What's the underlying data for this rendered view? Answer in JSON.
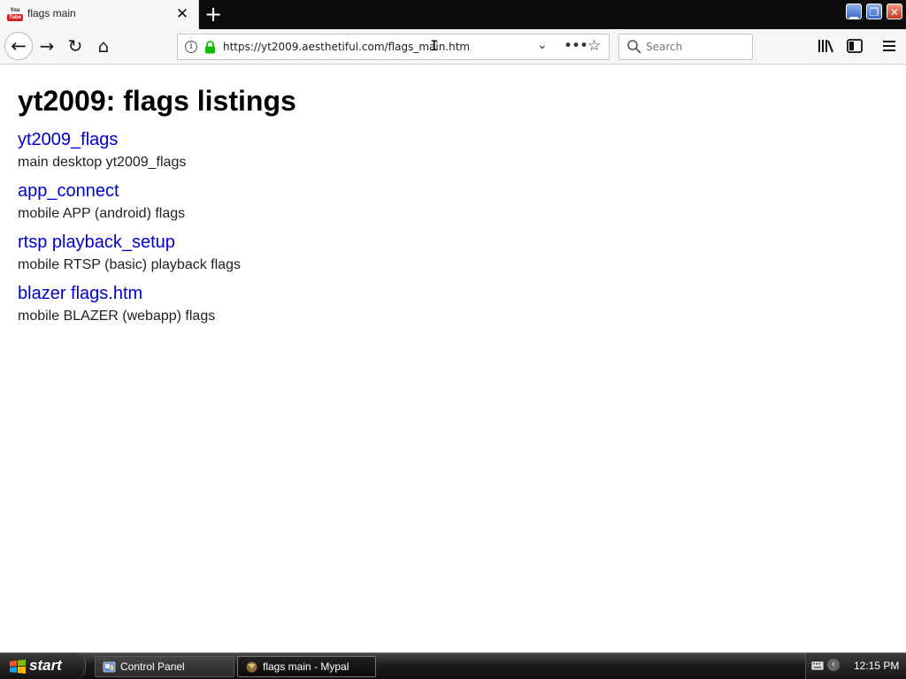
{
  "browser": {
    "tab": {
      "favicon_top": "You",
      "favicon_bottom": "Tube",
      "title": "flags main",
      "close_glyph": "✕"
    },
    "new_tab_glyph": "+",
    "window_controls": {
      "minimize": "▁",
      "maximize": "❐",
      "close": "✕"
    },
    "nav": {
      "back": "←",
      "forward": "→",
      "reload": "↻",
      "home": "⌂"
    },
    "url": "https://yt2009.aesthetiful.com/flags_main.htm",
    "url_info_glyph": "i",
    "url_dropdown_glyph": "⌄",
    "url_more_glyph": "•••",
    "url_star_glyph": "☆",
    "search_placeholder": "Search",
    "accent_lock_color": "#12bc00"
  },
  "page": {
    "title": "yt2009: flags listings",
    "entries": [
      {
        "link": "yt2009_flags",
        "description": "main desktop yt2009_flags"
      },
      {
        "link": "app_connect",
        "description": "mobile APP (android) flags"
      },
      {
        "link": "rtsp playback_setup",
        "description": "mobile RTSP (basic) playback flags"
      },
      {
        "link": "blazer flags.htm",
        "description": "mobile BLAZER (webapp) flags"
      }
    ],
    "link_color": "#0000cc"
  },
  "taskbar": {
    "start_label": "start",
    "tasks": [
      {
        "label": "Control Panel",
        "icon": "control-panel-icon"
      },
      {
        "label": "flags main - Mypal",
        "icon": "mypal-icon"
      }
    ],
    "tray_collapse_glyph": "‹",
    "clock": "12:15 PM"
  }
}
